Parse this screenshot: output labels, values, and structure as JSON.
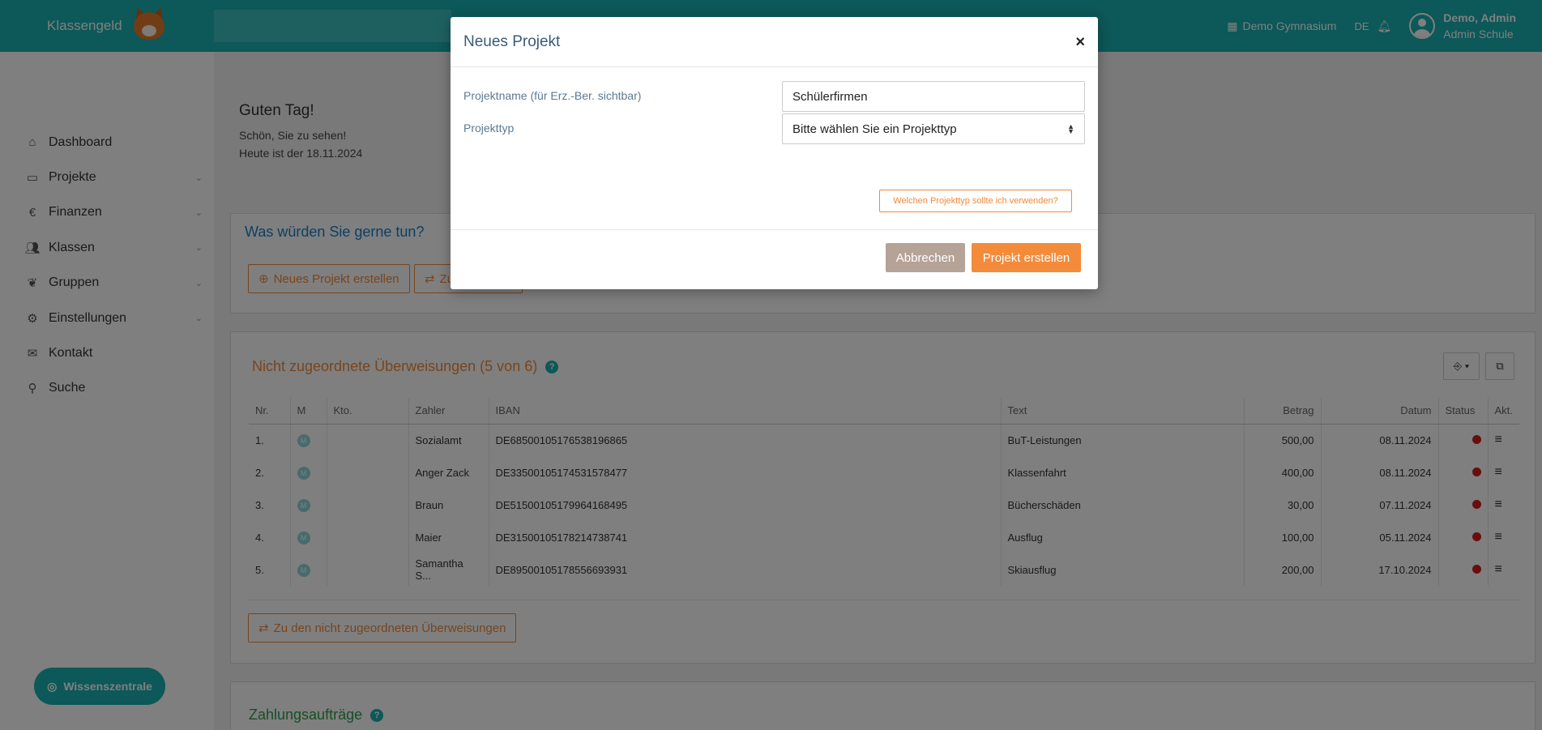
{
  "topbar": {
    "brand": "Klassengeld",
    "school": "Demo Gymnasium",
    "lang": "DE",
    "user_name": "Demo, Admin",
    "user_role": "Admin Schule",
    "accent": "#1ab0b0"
  },
  "sidebar": {
    "items": [
      {
        "label": "Dashboard",
        "icon": "home-icon"
      },
      {
        "label": "Projekte",
        "icon": "card-icon"
      },
      {
        "label": "Finanzen",
        "icon": "euro-icon"
      },
      {
        "label": "Klassen",
        "icon": "users-icon"
      },
      {
        "label": "Gruppen",
        "icon": "leaf-icon"
      },
      {
        "label": "Einstellungen",
        "icon": "gear-icon"
      },
      {
        "label": "Kontakt",
        "icon": "envelope-icon"
      },
      {
        "label": "Suche",
        "icon": "search-icon"
      }
    ],
    "knowledge_button": "Wissenszentrale"
  },
  "greeting": {
    "title": "Guten Tag!",
    "line1": "Schön, Sie zu sehen!",
    "line2": "Heute ist der 18.11.2024"
  },
  "actions_panel": {
    "title": "Was würden Sie gerne tun?",
    "btn_new_project": "Neues Projekt erstellen",
    "btn_second": "Zu"
  },
  "transfers_panel": {
    "title": "Nicht zugeordnete Überweisungen (5 von 6)",
    "columns": [
      "Nr.",
      "M",
      "Kto.",
      "Zahler",
      "IBAN",
      "Text",
      "Betrag",
      "Datum",
      "Status",
      "Akt."
    ],
    "rows": [
      {
        "nr": "1.",
        "m": "M",
        "kto": "",
        "zahler": "Sozialamt",
        "iban": "DE68500105176538196865",
        "text": "BuT-Leistungen",
        "betrag": "500,00",
        "datum": "08.11.2024"
      },
      {
        "nr": "2.",
        "m": "M",
        "kto": "",
        "zahler": "Anger Zack",
        "iban": "DE33500105174531578477",
        "text": "Klassenfahrt",
        "betrag": "400,00",
        "datum": "08.11.2024"
      },
      {
        "nr": "3.",
        "m": "M",
        "kto": "",
        "zahler": "Braun",
        "iban": "DE51500105179964168495",
        "text": "Bücherschäden",
        "betrag": "30,00",
        "datum": "07.11.2024"
      },
      {
        "nr": "4.",
        "m": "M",
        "kto": "",
        "zahler": "Maier",
        "iban": "DE31500105178214738741",
        "text": "Ausflug",
        "betrag": "100,00",
        "datum": "05.11.2024"
      },
      {
        "nr": "5.",
        "m": "M",
        "kto": "",
        "zahler": "Samantha S...",
        "iban": "DE89500105178556693931",
        "text": "Skiausflug",
        "betrag": "200,00",
        "datum": "17.10.2024"
      }
    ],
    "footer_button": "Zu den nicht zugeordneten Überweisungen",
    "status_color": "#d01c1c"
  },
  "orders_panel": {
    "title": "Zahlungsaufträge"
  },
  "modal": {
    "title": "Neues Projekt",
    "close": "×",
    "name_label": "Projektname (für Erz.-Ber. sichtbar)",
    "name_value": "Schülerfirmen",
    "type_label": "Projekttyp",
    "type_value": "Bitte wählen Sie ein Projekttyp",
    "help_button": "Welchen Projekttyp sollte ich verwenden?",
    "cancel": "Abbrechen",
    "create": "Projekt erstellen"
  }
}
